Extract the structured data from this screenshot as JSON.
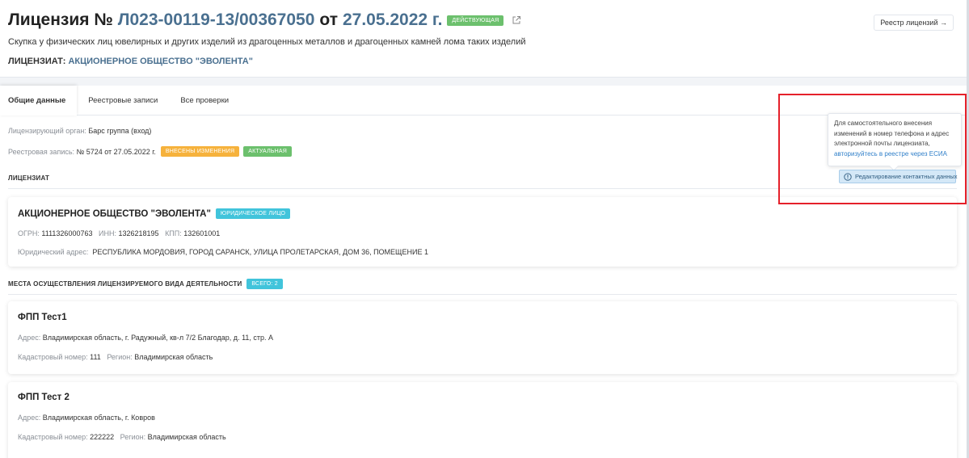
{
  "header": {
    "title_prefix": "Лицензия №",
    "license_number": "Л023-00119-13/00367050",
    "title_from": "от",
    "license_date": "27.05.2022 г.",
    "status_badge": "ДЕЙСТВУЮЩАЯ",
    "subtitle": "Скупка у физических лиц ювелирных и других изделий из драгоценных металлов и драгоценных камней лома таких изделий",
    "licensee_label": "ЛИЦЕНЗИАТ:",
    "licensee_name": "АКЦИОНЕРНОЕ ОБЩЕСТВО \"ЭВОЛЕНТА\"",
    "registry_button": "Реестр лицензий →"
  },
  "tabs": [
    "Общие данные",
    "Реестровые записи",
    "Все проверки"
  ],
  "general": {
    "authority_label": "Лицензирующий орган:",
    "authority_value": "Барс группа (вход)",
    "registry_label": "Реестровая запись:",
    "registry_value": "№ 5724 от 27.05.2022 г.",
    "badge_changed": "ВНЕСЕНЫ ИЗМЕНЕНИЯ",
    "badge_actual": "АКТУАЛЬНАЯ"
  },
  "licensee_section": {
    "title": "ЛИЦЕНЗИАТ",
    "org_name": "АКЦИОНЕРНОЕ ОБЩЕСТВО \"ЭВОЛЕНТА\"",
    "org_type_badge": "ЮРИДИЧЕСКОЕ ЛИЦО",
    "ogrn_label": "ОГРН:",
    "ogrn_value": "1111326000763",
    "inn_label": "ИНН:",
    "inn_value": "1326218195",
    "kpp_label": "КПП:",
    "kpp_value": "132601001",
    "address_label": "Юридический адрес:",
    "address_value": "РЕСПУБЛИКА МОРДОВИЯ, ГОРОД САРАНСК, УЛИЦА ПРОЛЕТАРСКАЯ, ДОМ 36, ПОМЕЩЕНИЕ 1"
  },
  "places_section": {
    "title": "МЕСТА ОСУЩЕСТВЛЕНИЯ ЛИЦЕНЗИРУЕМОГО ВИДА ДЕЯТЕЛЬНОСТИ",
    "count_badge": "ВСЕГО: 2",
    "items": [
      {
        "name": "ФПП Тест1",
        "address_label": "Адрес:",
        "address_value": "Владимирская область, г. Радужный, кв-л 7/2 Благодар, д. 11, стр. А",
        "cadastral_label": "Кадастровый номер:",
        "cadastral_value": "111",
        "region_label": "Регион:",
        "region_value": "Владимирская область"
      },
      {
        "name": "ФПП Тест 2",
        "address_label": "Адрес:",
        "address_value": "Владимирская область, г. Ковров",
        "cadastral_label": "Кадастровый номер:",
        "cadastral_value": "222222",
        "region_label": "Регион:",
        "region_value": "Владимирская область"
      }
    ]
  },
  "tooltip": {
    "text": "Для самостоятельного внесения изменений в номер телефона и адрес электронной почты лицензиата,",
    "link": "авторизуйтесь в реестре через ЕСИА",
    "button": "Редактирование контактных данных"
  },
  "colors": {
    "accent_blue": "#4a7090",
    "status_green": "#6cc06d",
    "status_orange": "#f6b23c",
    "badge_teal": "#41c4db",
    "link_blue": "#2f7fc9",
    "highlight_red": "#e5202a"
  },
  "icons": {
    "external_link": "external-link-icon",
    "info": "info-circle-icon"
  }
}
